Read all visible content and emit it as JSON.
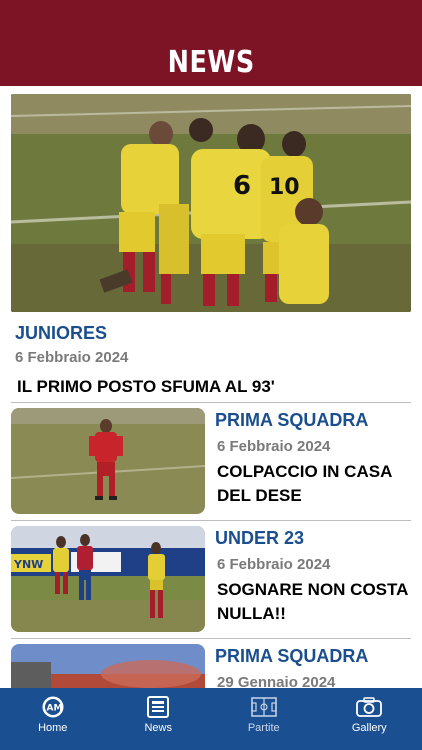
{
  "header": {
    "title": "NEWS"
  },
  "featured": {
    "category": "JUNIORES",
    "date": "6 Febbraio 2024",
    "headline": "IL PRIMO POSTO SFUMA AL 93'"
  },
  "items": [
    {
      "category": "PRIMA SQUADRA",
      "date": "6 Febbraio 2024",
      "headline": "COLPACCIO IN CASA DEL DESE"
    },
    {
      "category": "UNDER 23",
      "date": "6 Febbraio 2024",
      "headline": "SOGNARE NON COSTA NULLA!!"
    },
    {
      "category": "PRIMA SQUADRA",
      "date": "29 Gennaio 2024",
      "headline": ""
    }
  ],
  "tabbar": {
    "tabs": [
      {
        "label": "Home",
        "icon": "club-logo-icon"
      },
      {
        "label": "News",
        "icon": "news-icon"
      },
      {
        "label": "Partite",
        "icon": "pitch-icon"
      },
      {
        "label": "Gallery",
        "icon": "camera-icon"
      }
    ]
  },
  "colors": {
    "header": "#7d1426",
    "accent_blue": "#1b4e8e",
    "tabbar": "#1a4f92"
  }
}
